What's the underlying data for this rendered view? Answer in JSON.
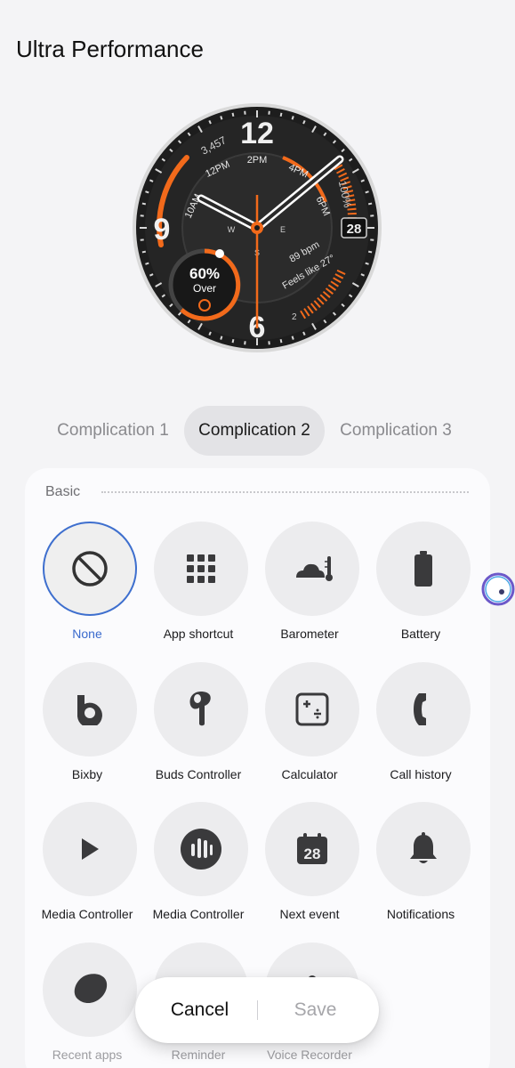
{
  "title": "Ultra Performance",
  "watch_face": {
    "hour_numerals": [
      "12",
      "9",
      "6"
    ],
    "inner_hours": [
      "2PM",
      "12PM",
      "4PM",
      "10AM",
      "6PM"
    ],
    "steps": "3,457",
    "battery": "100%",
    "date": "28",
    "compass": [
      "W",
      "E",
      "S"
    ],
    "heart_rate": "89 bpm",
    "weather": "Feels like 27°",
    "percent": "60%",
    "over_label": "Over",
    "small_num": "2",
    "accent_color": "#f26a1b"
  },
  "tabs": [
    {
      "label": "Complication 1",
      "active": false
    },
    {
      "label": "Complication 2",
      "active": true
    },
    {
      "label": "Complication 3",
      "active": false
    }
  ],
  "section": {
    "label": "Basic"
  },
  "items": [
    {
      "label": "None",
      "icon": "none-icon",
      "selected": true
    },
    {
      "label": "App shortcut",
      "icon": "app-grid-icon"
    },
    {
      "label": "Barometer",
      "icon": "barometer-icon"
    },
    {
      "label": "Battery",
      "icon": "battery-icon"
    },
    {
      "label": "Bixby",
      "icon": "bixby-icon"
    },
    {
      "label": "Buds Controller",
      "icon": "earbud-icon"
    },
    {
      "label": "Calculator",
      "icon": "calculator-icon"
    },
    {
      "label": "Call history",
      "icon": "phone-icon"
    },
    {
      "label": "Media Controller",
      "icon": "play-icon"
    },
    {
      "label": "Media Controller",
      "icon": "audio-bars-icon"
    },
    {
      "label": "Next event",
      "icon": "calendar-icon"
    },
    {
      "label": "Notifications",
      "icon": "bell-icon"
    },
    {
      "label": "Recent apps",
      "icon": "recent-apps-icon"
    },
    {
      "label": "Reminder",
      "icon": "reminder-icon"
    },
    {
      "label": "Voice Recorder",
      "icon": "microphone-icon"
    }
  ],
  "actions": {
    "cancel": "Cancel",
    "save": "Save"
  },
  "colors": {
    "selected": "#3e6fce",
    "accent": "#f26a1b",
    "icon": "#3a3a3c"
  }
}
